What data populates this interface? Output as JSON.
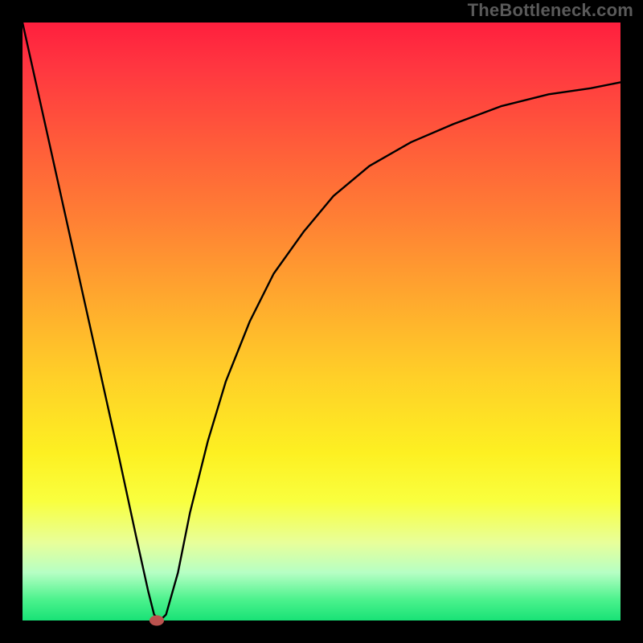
{
  "watermark": "TheBottleneck.com",
  "chart_data": {
    "type": "line",
    "title": "",
    "xlabel": "",
    "ylabel": "",
    "xlim": [
      0,
      100
    ],
    "ylim": [
      0,
      100
    ],
    "grid": false,
    "background": "red-yellow-green vertical gradient (100→0)",
    "series": [
      {
        "name": "bottleneck-curve",
        "color": "#000000",
        "x": [
          0,
          4,
          8,
          12,
          16,
          19,
          21,
          22,
          23,
          24,
          26,
          28,
          31,
          34,
          38,
          42,
          47,
          52,
          58,
          65,
          72,
          80,
          88,
          95,
          100
        ],
        "y": [
          100,
          82,
          64,
          46,
          28,
          14,
          5,
          1,
          0,
          1,
          8,
          18,
          30,
          40,
          50,
          58,
          65,
          71,
          76,
          80,
          83,
          86,
          88,
          89,
          90
        ]
      }
    ],
    "marker": {
      "x": 22.5,
      "y": 0,
      "color": "#bb524e"
    },
    "gradient_stops": [
      {
        "pct": 0,
        "color": "#ff1f3e"
      },
      {
        "pct": 8,
        "color": "#ff3840"
      },
      {
        "pct": 20,
        "color": "#ff5b3a"
      },
      {
        "pct": 33,
        "color": "#ff8034"
      },
      {
        "pct": 46,
        "color": "#ffa82e"
      },
      {
        "pct": 59,
        "color": "#ffcf28"
      },
      {
        "pct": 72,
        "color": "#fdf022"
      },
      {
        "pct": 80,
        "color": "#f9ff3e"
      },
      {
        "pct": 87,
        "color": "#e8ff9a"
      },
      {
        "pct": 92,
        "color": "#b6ffc4"
      },
      {
        "pct": 96.5,
        "color": "#4cf28d"
      },
      {
        "pct": 100,
        "color": "#18e276"
      }
    ]
  }
}
